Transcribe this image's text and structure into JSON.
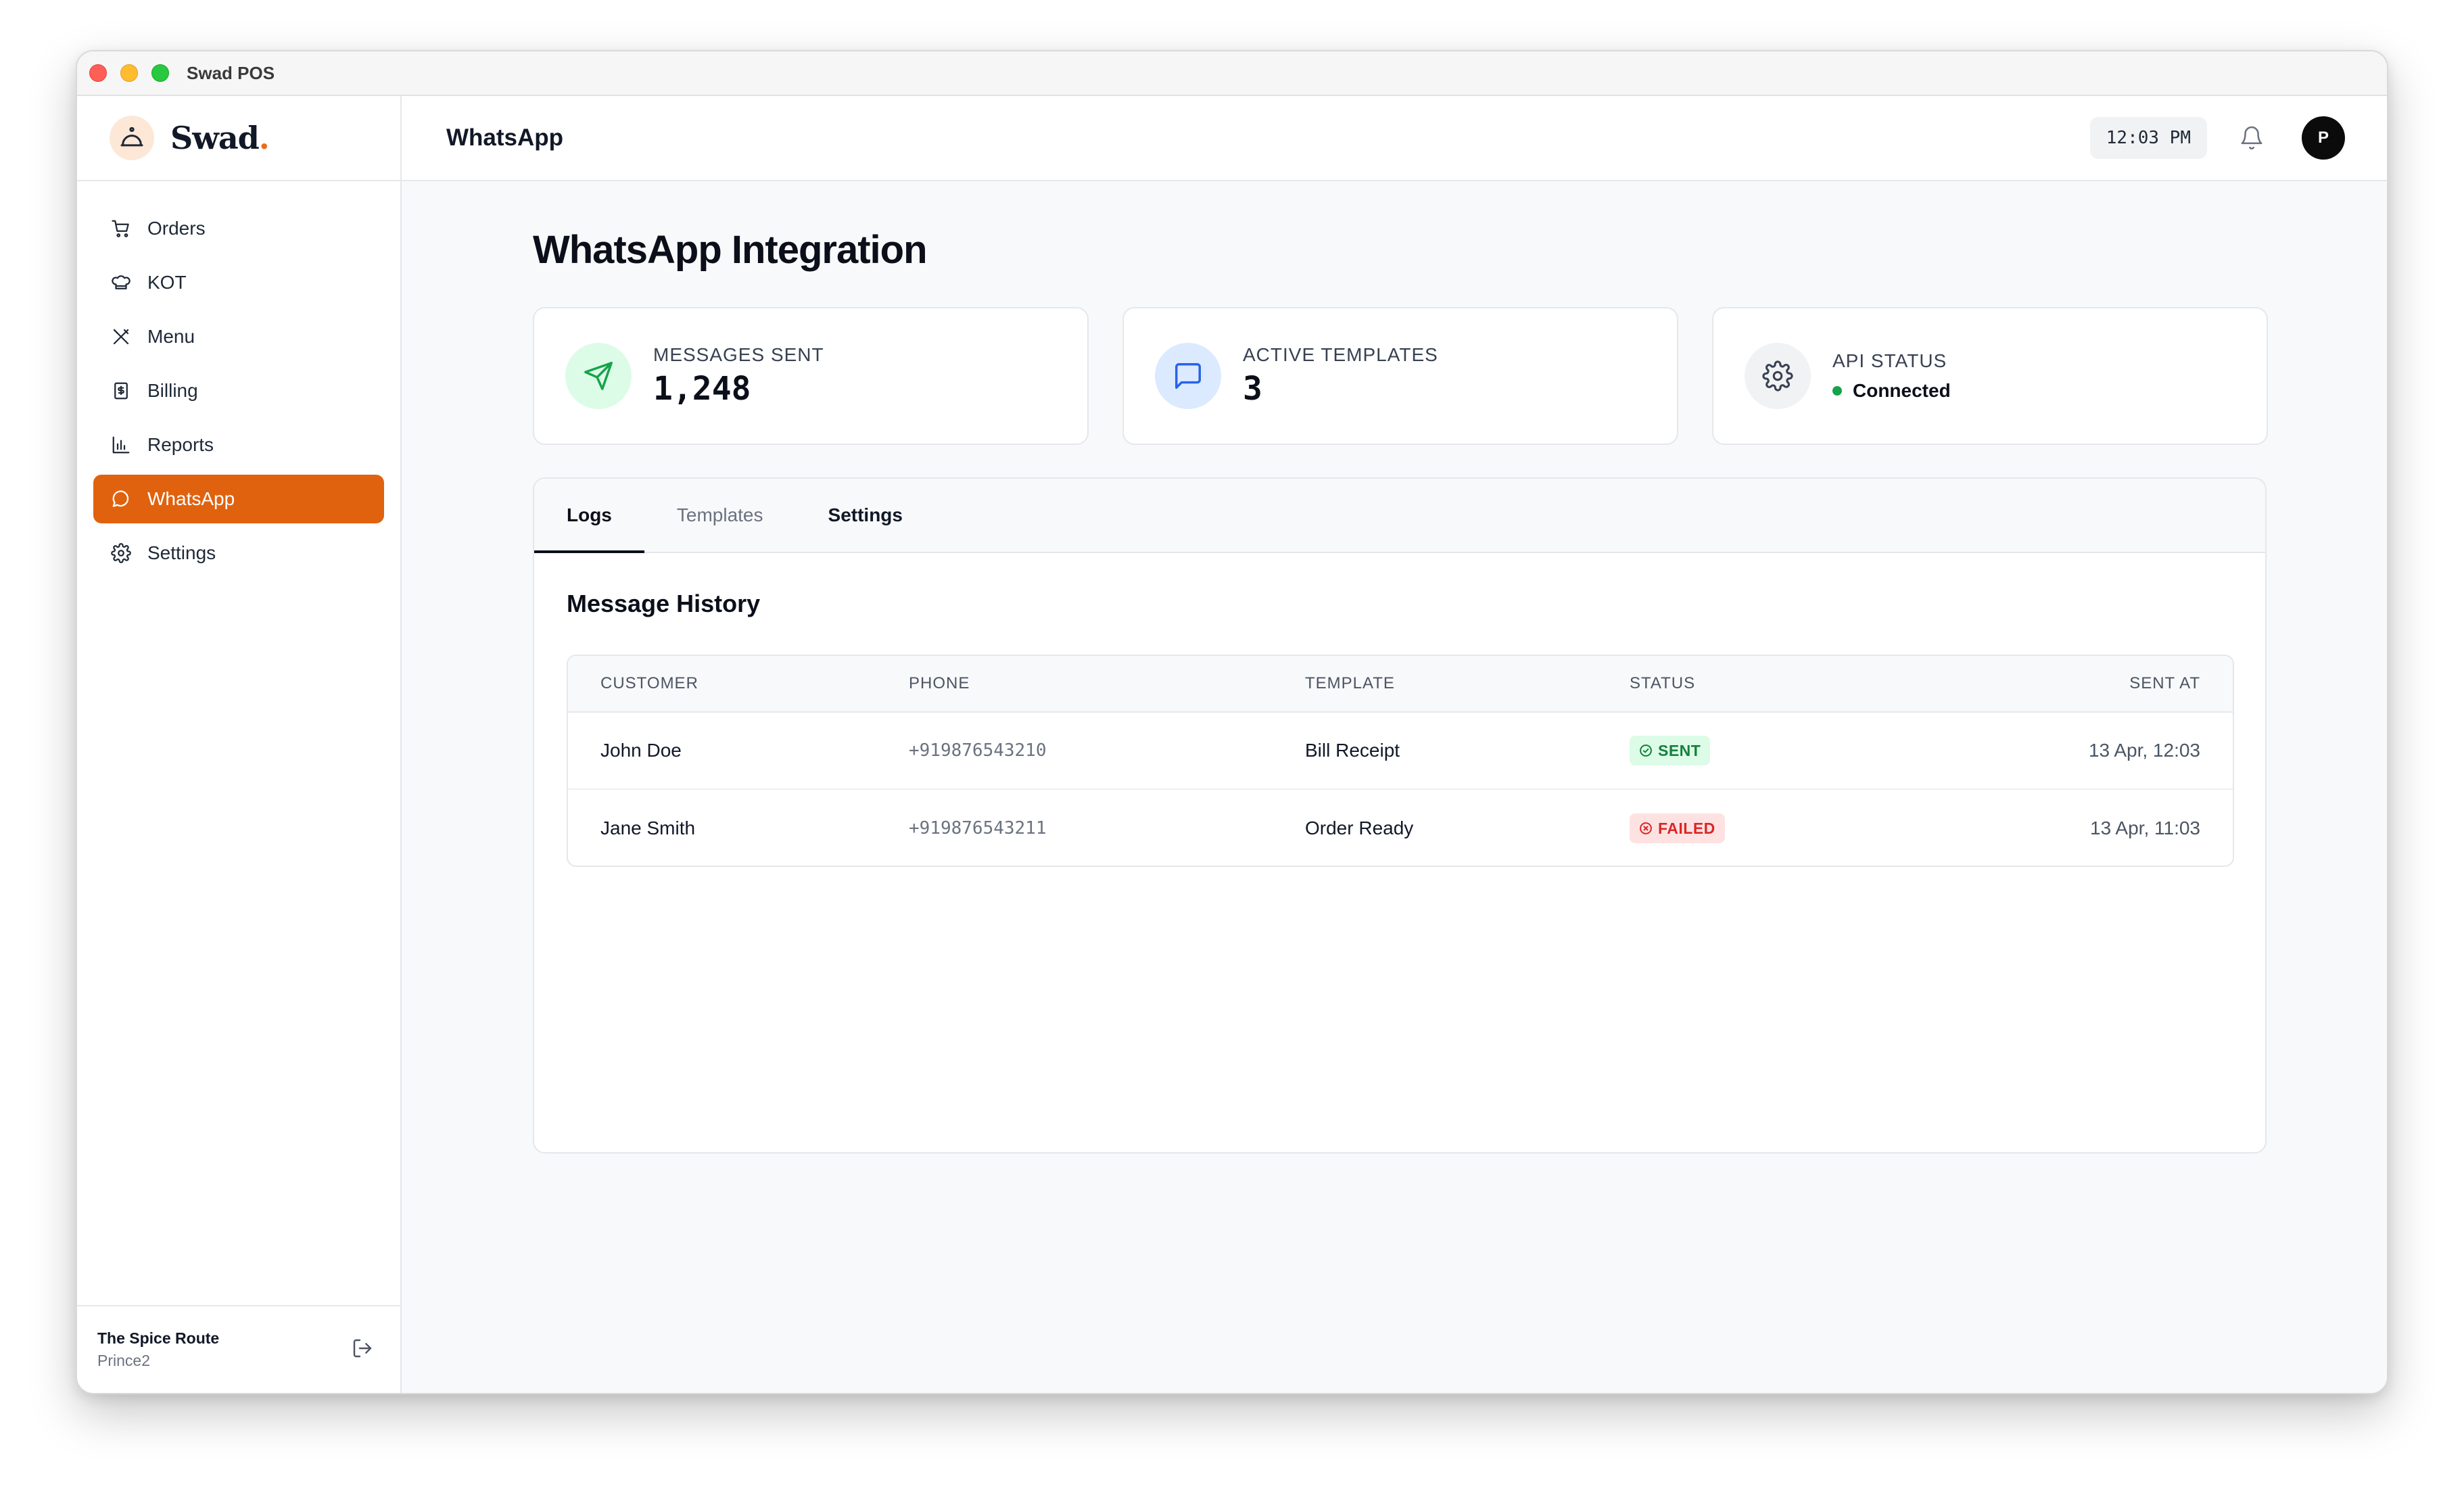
{
  "window": {
    "title": "Swad POS"
  },
  "brand": {
    "name": "Swad",
    "dot": "."
  },
  "sidebar": {
    "items": [
      {
        "label": "Orders",
        "icon": "cart-icon"
      },
      {
        "label": "KOT",
        "icon": "chef-hat-icon"
      },
      {
        "label": "Menu",
        "icon": "utensils-icon"
      },
      {
        "label": "Billing",
        "icon": "receipt-icon"
      },
      {
        "label": "Reports",
        "icon": "bar-chart-icon"
      },
      {
        "label": "WhatsApp",
        "icon": "message-circle-icon",
        "active": true
      },
      {
        "label": "Settings",
        "icon": "gear-icon"
      }
    ],
    "footer": {
      "restaurant": "The Spice Route",
      "user": "Prince2"
    }
  },
  "header": {
    "title": "WhatsApp",
    "time": "12:03 PM",
    "avatar_initial": "P"
  },
  "main": {
    "title": "WhatsApp Integration",
    "stats": [
      {
        "label": "MESSAGES SENT",
        "value": "1,248",
        "icon": "send-icon",
        "color": "#dcfce7"
      },
      {
        "label": "ACTIVE TEMPLATES",
        "value": "3",
        "icon": "message-square-icon",
        "color": "#dbeafe"
      },
      {
        "label": "API STATUS",
        "value": "Connected",
        "icon": "gear-icon",
        "color": "#f1f2f4"
      }
    ],
    "tabs": [
      "Logs",
      "Templates",
      "Settings"
    ],
    "section_title": "Message History",
    "table": {
      "headers": [
        "CUSTOMER",
        "PHONE",
        "TEMPLATE",
        "STATUS",
        "SENT AT"
      ],
      "rows": [
        {
          "customer": "John Doe",
          "phone": "+919876543210",
          "template": "Bill Receipt",
          "status": "SENT",
          "sent_at": "13 Apr, 12:03"
        },
        {
          "customer": "Jane Smith",
          "phone": "+919876543211",
          "template": "Order Ready",
          "status": "FAILED",
          "sent_at": "13 Apr, 11:03"
        }
      ]
    }
  },
  "colors": {
    "accent": "#e0620f",
    "success": "#16a34a",
    "danger": "#dc2626"
  }
}
